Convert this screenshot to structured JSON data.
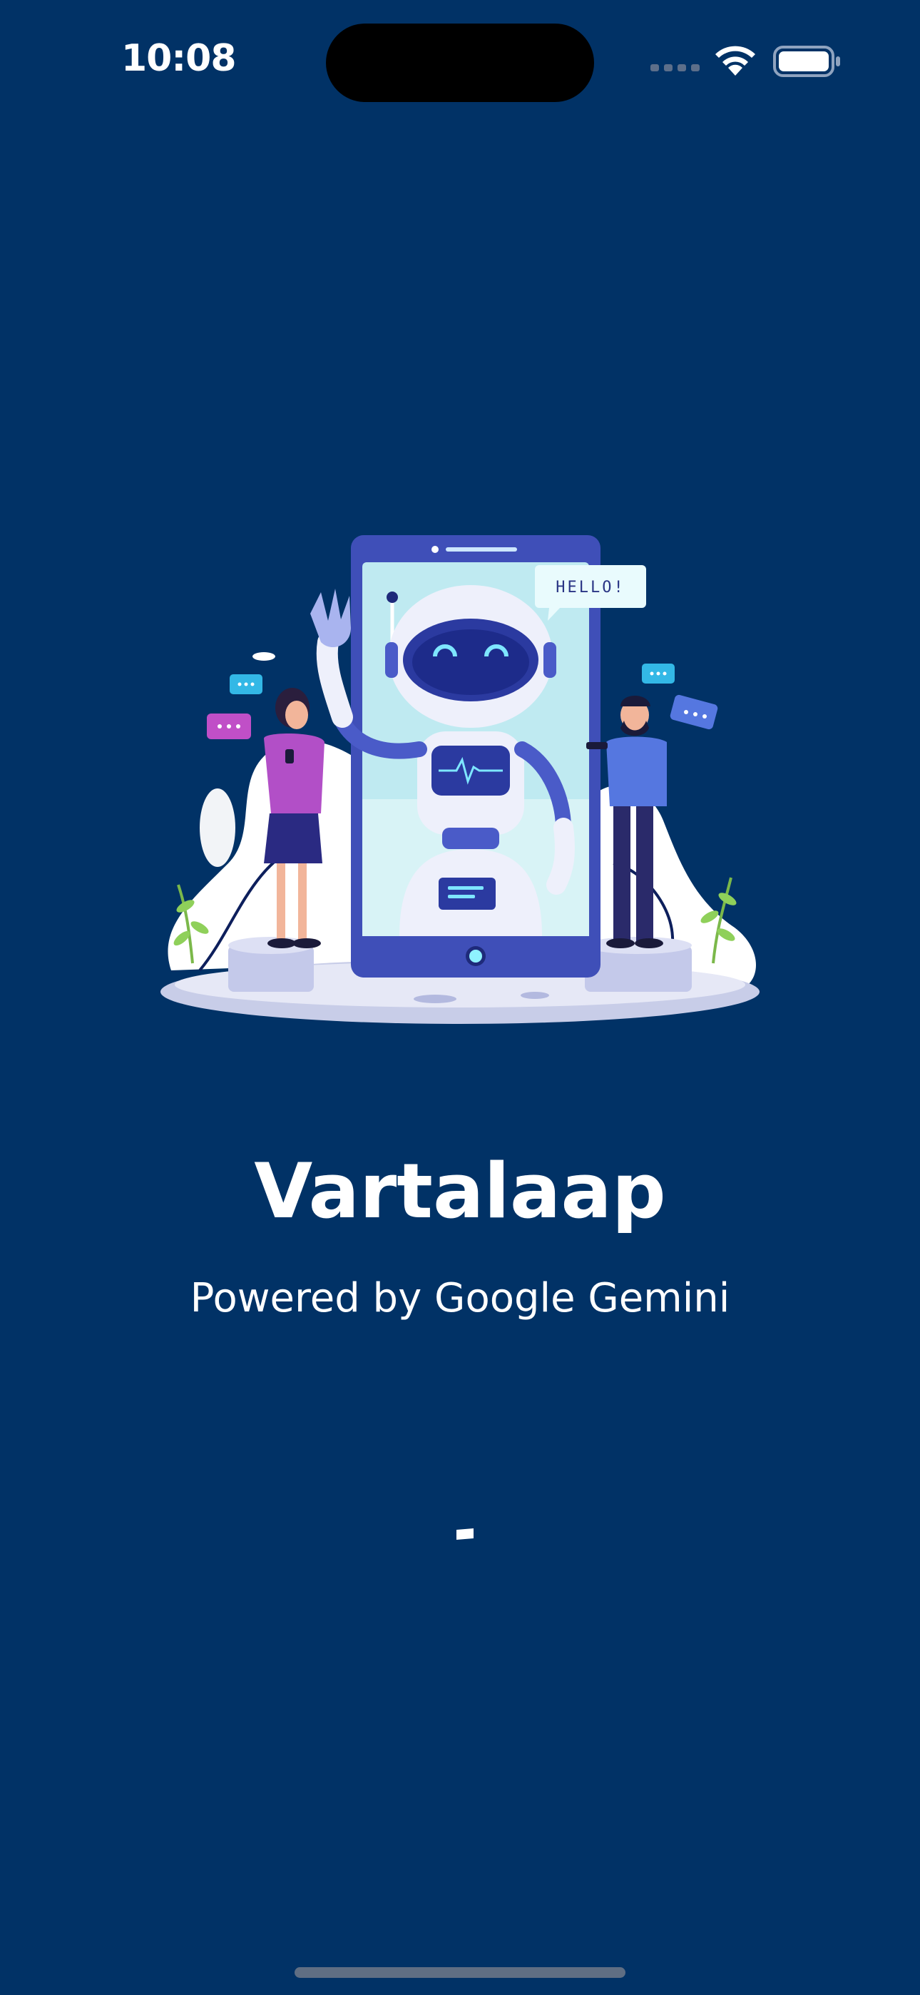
{
  "status_bar": {
    "time": "10:08",
    "icons": [
      "signal-icon",
      "wifi-icon",
      "battery-icon"
    ]
  },
  "illustration": {
    "icon": "robot-chat-illustration",
    "speech_bubble": "HELLO!"
  },
  "splash": {
    "title": "Vartalaap",
    "subtitle": "Powered by Google Gemini"
  },
  "colors": {
    "background": "#013266",
    "text": "#FFFFFF",
    "accent": "#3F51B5"
  }
}
